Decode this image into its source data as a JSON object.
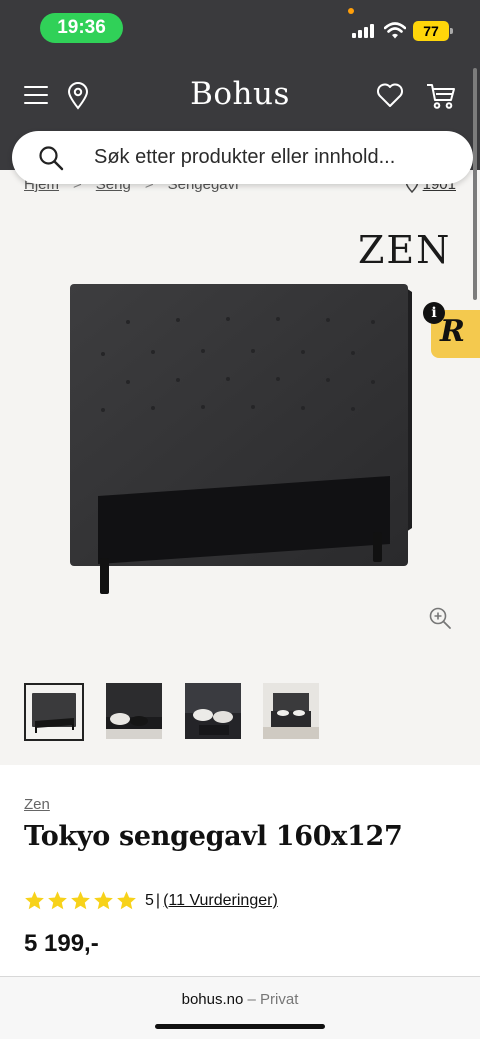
{
  "status_bar": {
    "time": "19:36",
    "battery": "77"
  },
  "header": {
    "logo": "Bohus",
    "icons": [
      "menu-icon",
      "location-pin-icon",
      "heart-icon",
      "cart-icon"
    ]
  },
  "search": {
    "placeholder": "Søk etter produkter eller innhold..."
  },
  "breadcrumb": {
    "items": [
      "Hjem",
      "Seng",
      "Sengegavl"
    ],
    "store": "1901"
  },
  "gallery": {
    "brand_logo": "ZEN",
    "thumbnail_count": 4,
    "active_index": 0
  },
  "product": {
    "brand": "Zen",
    "title": "Tokyo sengegavl 160x127",
    "rating": 5,
    "rating_text": "5",
    "rating_separator": "|",
    "reviews_text": "(11 Vurderinger)",
    "price": "5 199,-"
  },
  "browser": {
    "domain": "bohus.no",
    "mode": "– Privat"
  },
  "colors": {
    "header_bg": "#3a3a3d",
    "star": "#f7d21a",
    "badge": "#f4c94e"
  }
}
